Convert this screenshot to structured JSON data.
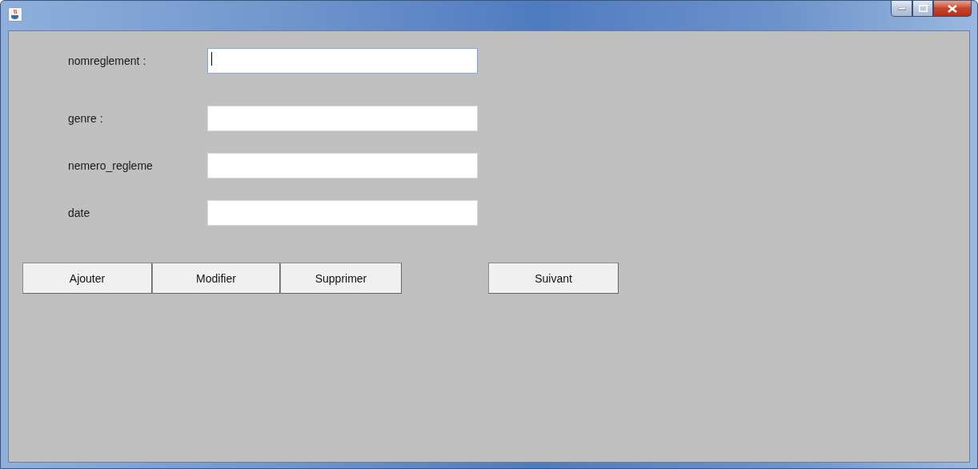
{
  "form": {
    "fields": [
      {
        "label": "nomreglement :",
        "focused": true
      },
      {
        "label": "genre :",
        "focused": false
      },
      {
        "label": "nemero_regleme",
        "focused": false
      },
      {
        "label": "date",
        "focused": false
      }
    ]
  },
  "actions": [
    "Ajouter",
    "Modifier",
    "Supprimer"
  ],
  "next_button": "Suivant"
}
